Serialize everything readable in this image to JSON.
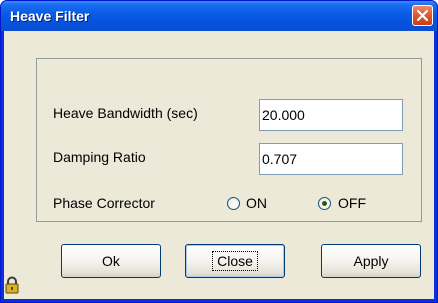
{
  "window": {
    "title": "Heave Filter"
  },
  "form": {
    "heave_bandwidth": {
      "label": "Heave Bandwidth (sec)",
      "value": "20.000"
    },
    "damping_ratio": {
      "label": "Damping Ratio",
      "value": "0.707"
    },
    "phase_corrector": {
      "label": "Phase Corrector",
      "options": [
        {
          "label": "ON",
          "selected": false
        },
        {
          "label": "OFF",
          "selected": true
        }
      ]
    }
  },
  "buttons": {
    "ok": "Ok",
    "close": "Close",
    "apply": "Apply"
  },
  "icons": {
    "close": "close-icon",
    "lock": "lock-icon"
  },
  "colors": {
    "titlebar": "#0a5ce8",
    "close_button": "#e2582f",
    "dialog_face": "#ece9d8",
    "field_border": "#7f9db9",
    "radio_selected_dot": "#1f5e16"
  }
}
